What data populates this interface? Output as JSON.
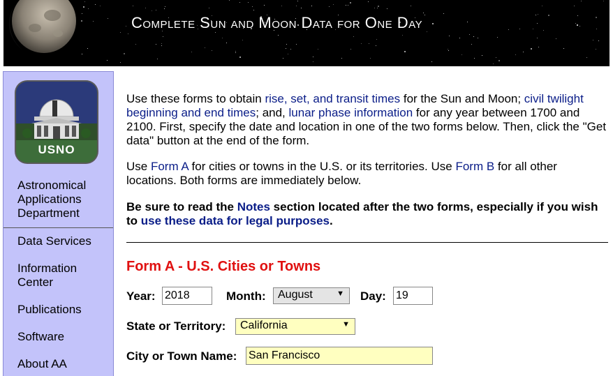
{
  "banner": {
    "title": "Complete Sun and Moon Data for One Day"
  },
  "sidebar": {
    "logo_text": "USNO",
    "dept_name": "Astronomical Applications Department",
    "items": [
      {
        "label": "Data Services"
      },
      {
        "label": "Information Center"
      },
      {
        "label": "Publications"
      },
      {
        "label": "Software"
      },
      {
        "label": "About AA"
      }
    ]
  },
  "intro": {
    "p1_a": "Use these forms to obtain ",
    "p1_link1": "rise, set, and transit times",
    "p1_b": " for the Sun and Moon; ",
    "p1_link2": "civil twilight beginning and end times",
    "p1_c": "; and, ",
    "p1_link3": "lunar phase information",
    "p1_d": " for any year between 1700 and 2100. First, specify the date and location in one of the two forms below. Then, click the \"Get data\" button at the end of the form.",
    "p2_a": "Use ",
    "p2_link1": "Form A",
    "p2_b": " for cities or towns in the U.S. or its territories. Use ",
    "p2_link2": "Form B",
    "p2_c": " for all other locations. Both forms are immediately below.",
    "p3_a": "Be sure to read the ",
    "p3_link1": "Notes",
    "p3_b": " section located after the two forms, especially if you wish to ",
    "p3_link2": "use these data for legal purposes",
    "p3_c": "."
  },
  "formA": {
    "heading": "Form A - U.S. Cities or Towns",
    "year_label": "Year:",
    "year_value": "2018",
    "month_label": "Month:",
    "month_value": "August",
    "day_label": "Day:",
    "day_value": "19",
    "state_label": "State or Territory:",
    "state_value": "California",
    "city_label": "City or Town Name:",
    "city_value": "San Francisco"
  },
  "colors": {
    "sidebar_bg": "#c3c3fa",
    "link": "#0a1d88",
    "heading_red": "#e01010",
    "input_yellow": "#ffffc0"
  }
}
